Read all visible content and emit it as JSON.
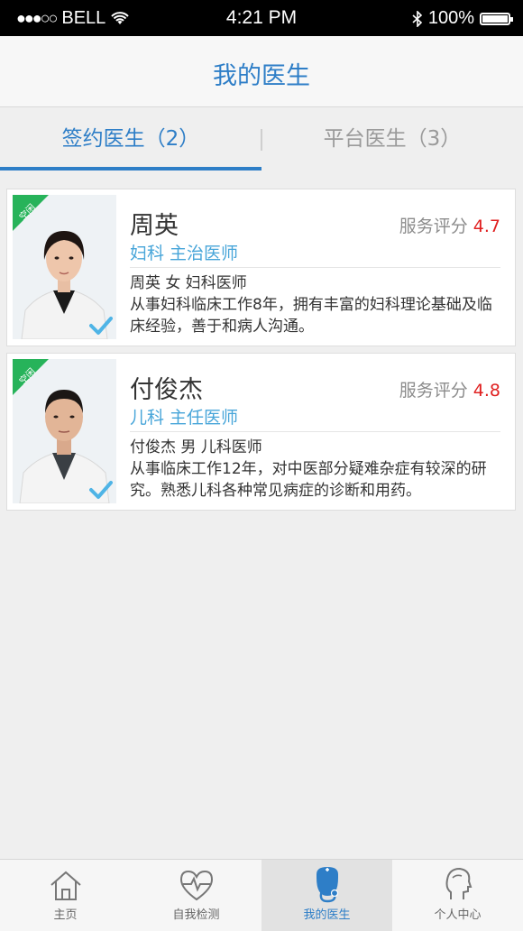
{
  "status_bar": {
    "signal": "●●●○○",
    "carrier": "BELL",
    "time": "4:21 PM",
    "battery": "100%"
  },
  "header": {
    "title": "我的医生"
  },
  "tabs": [
    {
      "label": "签约医生（2）",
      "active": true
    },
    {
      "label": "平台医生（3）",
      "active": false
    }
  ],
  "doctors": [
    {
      "name": "周英",
      "department": "妇科 主治医师",
      "rating_label": "服务评分",
      "rating": "4.7",
      "badge": "空闲",
      "intro": "周英 女 妇科医师",
      "description": "从事妇科临床工作8年，拥有丰富的妇科理论基础及临床经验，善于和病人沟通。"
    },
    {
      "name": "付俊杰",
      "department": "儿科 主任医师",
      "rating_label": "服务评分",
      "rating": "4.8",
      "badge": "空闲",
      "intro": "付俊杰 男 儿科医师",
      "description": "从事临床工作12年，对中医部分疑难杂症有较深的研究。熟悉儿科各种常见病症的诊断和用药。"
    }
  ],
  "tab_bar": [
    {
      "label": "主页",
      "icon": "home-icon",
      "active": false
    },
    {
      "label": "自我检测",
      "icon": "heart-pulse-icon",
      "active": false
    },
    {
      "label": "我的医生",
      "icon": "doctor-icon",
      "active": true
    },
    {
      "label": "个人中心",
      "icon": "person-icon",
      "active": false
    }
  ],
  "colors": {
    "accent": "#2e7ec7",
    "rating": "#e02020",
    "badge": "#27b35a",
    "department": "#47a5d9"
  }
}
